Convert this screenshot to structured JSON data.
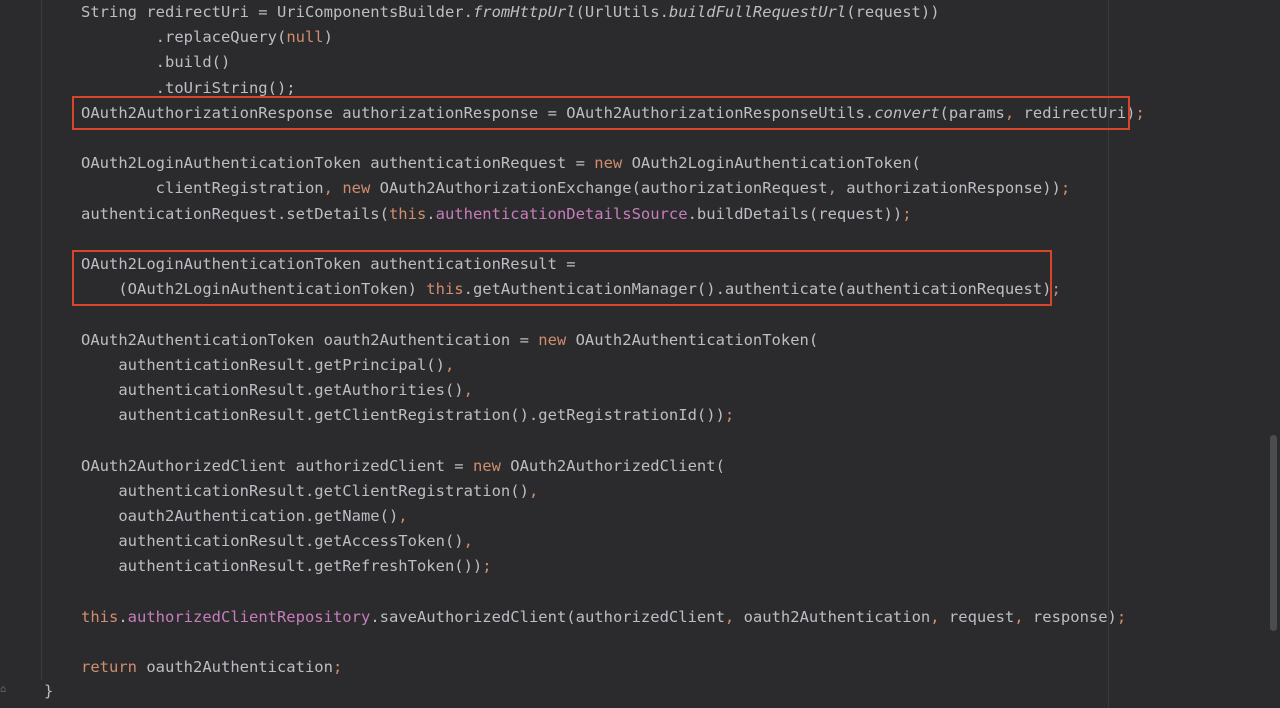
{
  "lines": [
    {
      "tokens": [
        {
          "t": "String redirectUri = UriComponentsBuilder."
        },
        {
          "t": "fromHttpUrl",
          "c": "italic"
        },
        {
          "t": "(UrlUtils."
        },
        {
          "t": "buildFullRequestUrl",
          "c": "italic"
        },
        {
          "t": "(request))"
        }
      ]
    },
    {
      "tokens": [
        {
          "t": "        .replaceQuery("
        },
        {
          "t": "null",
          "c": "kw"
        },
        {
          "t": ")"
        }
      ]
    },
    {
      "tokens": [
        {
          "t": "        .build()"
        }
      ]
    },
    {
      "tokens": [
        {
          "t": "        .toUriString();"
        }
      ]
    },
    {
      "tokens": [
        {
          "t": "OAuth2AuthorizationResponse authorizationResponse = OAuth2AuthorizationResponseUtils."
        },
        {
          "t": "convert",
          "c": "italic"
        },
        {
          "t": "(params"
        },
        {
          "t": ", ",
          "c": "kw"
        },
        {
          "t": "redirectUri)"
        },
        {
          "t": ";",
          "c": "kw"
        }
      ]
    },
    {
      "tokens": [
        {
          "t": ""
        }
      ]
    },
    {
      "tokens": [
        {
          "t": "OAuth2LoginAuthenticationToken authenticationRequest = "
        },
        {
          "t": "new ",
          "c": "kw"
        },
        {
          "t": "OAuth2LoginAuthenticationToken("
        }
      ]
    },
    {
      "tokens": [
        {
          "t": "        clientRegistration"
        },
        {
          "t": ", ",
          "c": "kw"
        },
        {
          "t": "new ",
          "c": "kw"
        },
        {
          "t": "OAuth2AuthorizationExchange(authorizationRequest"
        },
        {
          "t": ", ",
          "c": "kw"
        },
        {
          "t": "authorizationResponse))"
        },
        {
          "t": ";",
          "c": "kw"
        }
      ]
    },
    {
      "tokens": [
        {
          "t": "authenticationRequest.setDetails("
        },
        {
          "t": "this",
          "c": "kw"
        },
        {
          "t": "."
        },
        {
          "t": "authenticationDetailsSource",
          "c": "field"
        },
        {
          "t": ".buildDetails(request))"
        },
        {
          "t": ";",
          "c": "kw"
        }
      ]
    },
    {
      "tokens": [
        {
          "t": ""
        }
      ]
    },
    {
      "tokens": [
        {
          "t": "OAuth2LoginAuthenticationToken authenticationResult ="
        }
      ]
    },
    {
      "tokens": [
        {
          "t": "    (OAuth2LoginAuthenticationToken) "
        },
        {
          "t": "this",
          "c": "kw"
        },
        {
          "t": ".getAuthenticationManager().authenticate(authenticationRequest)"
        },
        {
          "t": ";",
          "c": "kw"
        }
      ]
    },
    {
      "tokens": [
        {
          "t": ""
        }
      ]
    },
    {
      "tokens": [
        {
          "t": "OAuth2AuthenticationToken oauth2Authentication = "
        },
        {
          "t": "new ",
          "c": "kw"
        },
        {
          "t": "OAuth2AuthenticationToken("
        }
      ]
    },
    {
      "tokens": [
        {
          "t": "    authenticationResult.getPrincipal()"
        },
        {
          "t": ",",
          "c": "kw"
        }
      ]
    },
    {
      "tokens": [
        {
          "t": "    authenticationResult.getAuthorities()"
        },
        {
          "t": ",",
          "c": "kw"
        }
      ]
    },
    {
      "tokens": [
        {
          "t": "    authenticationResult.getClientRegistration().getRegistrationId())"
        },
        {
          "t": ";",
          "c": "kw"
        }
      ]
    },
    {
      "tokens": [
        {
          "t": ""
        }
      ]
    },
    {
      "tokens": [
        {
          "t": "OAuth2AuthorizedClient authorizedClient = "
        },
        {
          "t": "new ",
          "c": "kw"
        },
        {
          "t": "OAuth2AuthorizedClient("
        }
      ]
    },
    {
      "tokens": [
        {
          "t": "    authenticationResult.getClientRegistration()"
        },
        {
          "t": ",",
          "c": "kw"
        }
      ]
    },
    {
      "tokens": [
        {
          "t": "    oauth2Authentication.getName()"
        },
        {
          "t": ",",
          "c": "kw"
        }
      ]
    },
    {
      "tokens": [
        {
          "t": "    authenticationResult.getAccessToken()"
        },
        {
          "t": ",",
          "c": "kw"
        }
      ]
    },
    {
      "tokens": [
        {
          "t": "    authenticationResult.getRefreshToken())"
        },
        {
          "t": ";",
          "c": "kw"
        }
      ]
    },
    {
      "tokens": [
        {
          "t": ""
        }
      ]
    },
    {
      "tokens": [
        {
          "t": "this",
          "c": "kw"
        },
        {
          "t": "."
        },
        {
          "t": "authorizedClientRepository",
          "c": "field"
        },
        {
          "t": ".saveAuthorizedClient(authorizedClient"
        },
        {
          "t": ", ",
          "c": "kw"
        },
        {
          "t": "oauth2Authentication"
        },
        {
          "t": ", ",
          "c": "kw"
        },
        {
          "t": "request"
        },
        {
          "t": ", ",
          "c": "kw"
        },
        {
          "t": "response)"
        },
        {
          "t": ";",
          "c": "kw"
        }
      ]
    },
    {
      "tokens": [
        {
          "t": ""
        }
      ]
    },
    {
      "tokens": [
        {
          "t": "return ",
          "c": "kw"
        },
        {
          "t": "oauth2Authentication"
        },
        {
          "t": ";",
          "c": "kw"
        }
      ]
    }
  ],
  "closing_brace": "}",
  "colors": {
    "background": "#2b2b2d",
    "text": "#bcbec4",
    "keyword": "#cf8e6d",
    "field": "#c77dbb",
    "highlight_border": "#d7452b"
  }
}
